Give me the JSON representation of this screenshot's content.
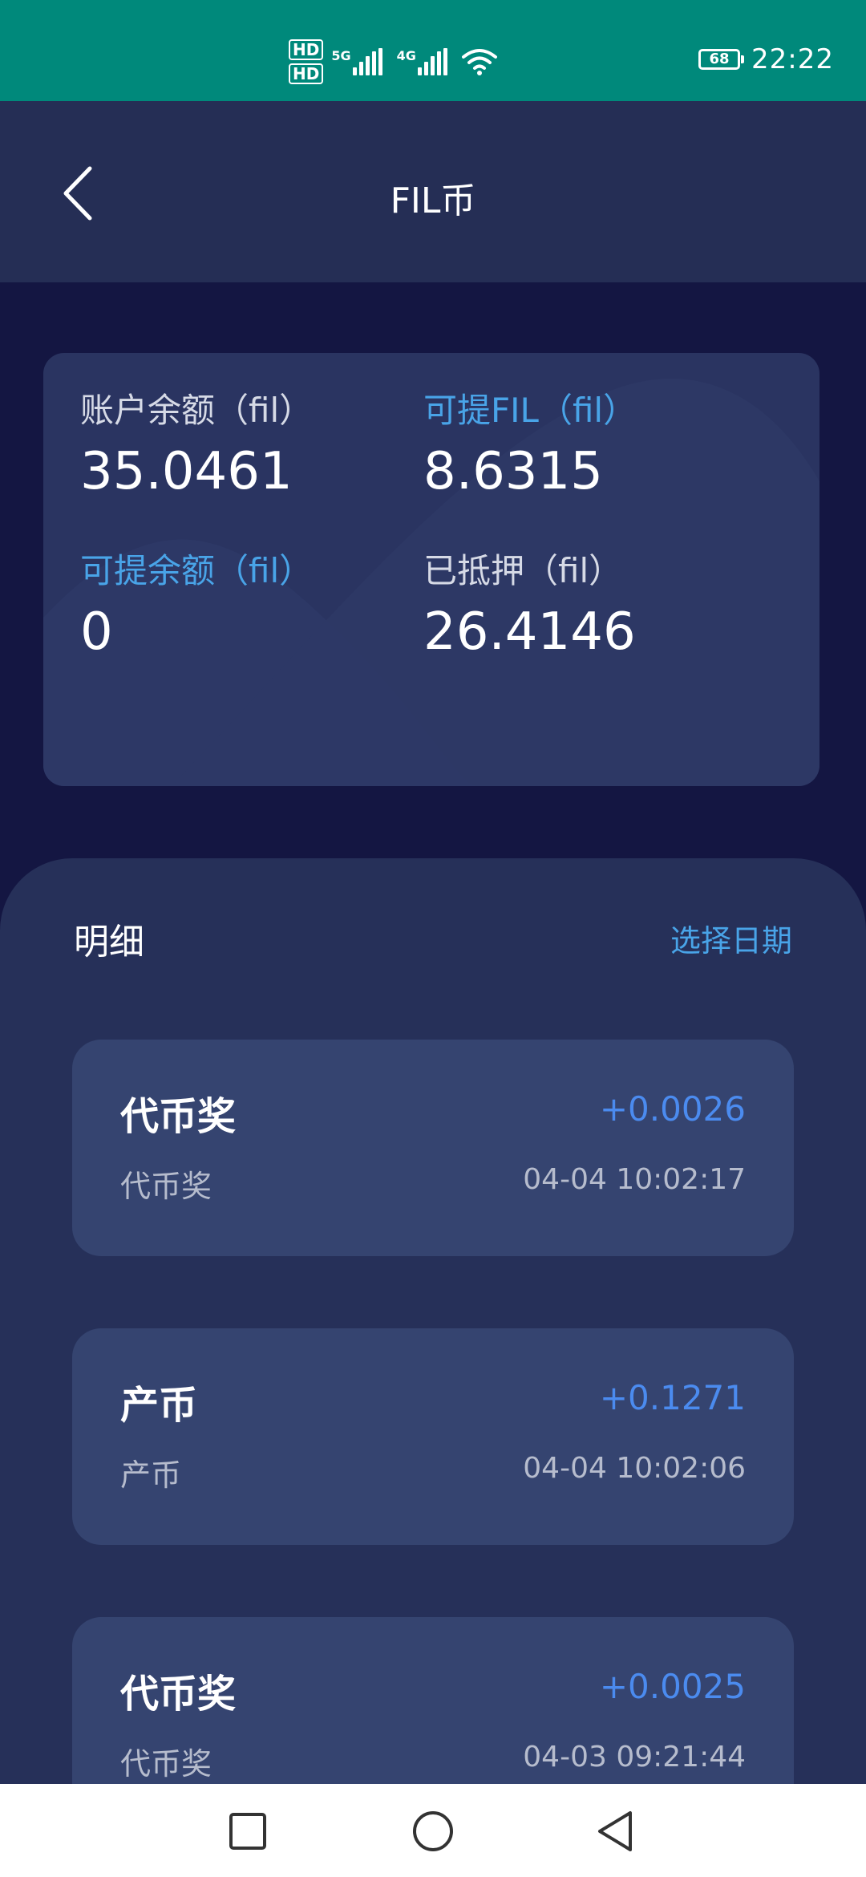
{
  "status_bar": {
    "hd1": "HD",
    "hd2": "HD",
    "net1": "5G",
    "net2": "4G",
    "battery": "68",
    "time": "22:22",
    "icons": [
      "signal-icon",
      "wifi-icon",
      "battery-icon"
    ]
  },
  "header": {
    "title": "FIL币",
    "back_icon": "chevron-left-icon"
  },
  "balances": {
    "account_balance": {
      "label": "账户余额（fil）",
      "value": "35.0461"
    },
    "withdrawable_fil": {
      "label": "可提FIL（fil）",
      "value": "8.6315"
    },
    "withdrawable_amount": {
      "label": "可提余额（fil）",
      "value": "0"
    },
    "pledged": {
      "label": "已抵押（fil）",
      "value": "26.4146"
    }
  },
  "detail": {
    "title": "明细",
    "select_date": "选择日期",
    "records": [
      {
        "title": "代币奖",
        "amount": "+0.0026",
        "desc": "代币奖",
        "time": "04-04 10:02:17"
      },
      {
        "title": "产币",
        "amount": "+0.1271",
        "desc": "产币",
        "time": "04-04 10:02:06"
      },
      {
        "title": "代币奖",
        "amount": "+0.0025",
        "desc": "代币奖",
        "time": "04-03 09:21:44"
      }
    ]
  },
  "navbar": {
    "icons": [
      "recent-apps-icon",
      "home-icon",
      "back-triangle-icon"
    ]
  },
  "colors": {
    "status_bar": "#00897b",
    "header": "#252e55",
    "page_bg": "#141642",
    "card": "#2a3461",
    "accent_blue": "#49a4e8",
    "amount_blue": "#4b8bef"
  }
}
